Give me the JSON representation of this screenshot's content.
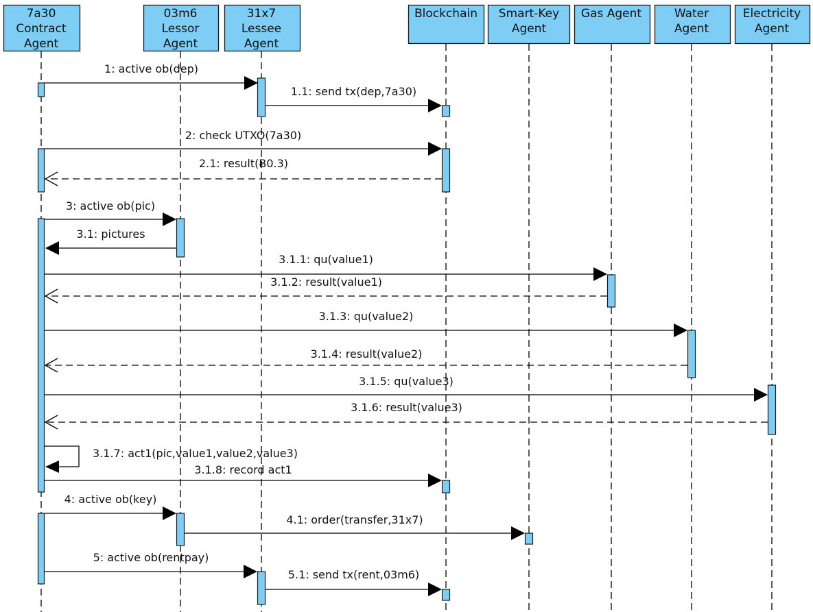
{
  "diagram": {
    "type": "sequence",
    "colors": {
      "box_fill": "#7dcdf4",
      "box_stroke": "#1a1a1a",
      "line": "#000000",
      "text": "#111111"
    },
    "participants": [
      {
        "id": "contract",
        "lines": [
          "7a30",
          "Contract",
          "Agent"
        ]
      },
      {
        "id": "lessor",
        "lines": [
          "03m6",
          "Lessor",
          "Agent"
        ]
      },
      {
        "id": "lessee",
        "lines": [
          "31x7",
          "Lessee",
          "Agent"
        ]
      },
      {
        "id": "blockchain",
        "lines": [
          "Blockchain"
        ]
      },
      {
        "id": "smartkey",
        "lines": [
          "Smart-Key",
          "Agent"
        ]
      },
      {
        "id": "gas",
        "lines": [
          "Gas Agent"
        ]
      },
      {
        "id": "water",
        "lines": [
          "Water",
          "Agent"
        ]
      },
      {
        "id": "electricity",
        "lines": [
          "Electricity",
          "Agent"
        ]
      }
    ],
    "messages": [
      {
        "seq": "1",
        "label": "1: active ob(dep)",
        "from": "contract",
        "to": "lessee",
        "kind": "sync"
      },
      {
        "seq": "1.1",
        "label": "1.1: send tx(dep,7a30)",
        "from": "lessee",
        "to": "blockchain",
        "kind": "sync"
      },
      {
        "seq": "2",
        "label": "2: check UTXO(7a30)",
        "from": "contract",
        "to": "blockchain",
        "kind": "sync"
      },
      {
        "seq": "2.1",
        "label": "2.1: result(Ƀ0.3)",
        "from": "blockchain",
        "to": "contract",
        "kind": "return"
      },
      {
        "seq": "3",
        "label": "3: active ob(pic)",
        "from": "contract",
        "to": "lessor",
        "kind": "sync"
      },
      {
        "seq": "3.1",
        "label": "3.1: pictures",
        "from": "lessor",
        "to": "contract",
        "kind": "sync"
      },
      {
        "seq": "3.1.1",
        "label": "3.1.1: qu(value1)",
        "from": "contract",
        "to": "gas",
        "kind": "sync"
      },
      {
        "seq": "3.1.2",
        "label": "3.1.2: result(value1)",
        "from": "gas",
        "to": "contract",
        "kind": "return"
      },
      {
        "seq": "3.1.3",
        "label": "3.1.3: qu(value2)",
        "from": "contract",
        "to": "water",
        "kind": "sync"
      },
      {
        "seq": "3.1.4",
        "label": "3.1.4: result(value2)",
        "from": "water",
        "to": "contract",
        "kind": "return"
      },
      {
        "seq": "3.1.5",
        "label": "3.1.5: qu(value3)",
        "from": "contract",
        "to": "electricity",
        "kind": "sync"
      },
      {
        "seq": "3.1.6",
        "label": "3.1.6: result(value3)",
        "from": "electricity",
        "to": "contract",
        "kind": "return"
      },
      {
        "seq": "3.1.7",
        "label": "3.1.7: act1(pic,value1,value2,value3)",
        "from": "contract",
        "to": "contract",
        "kind": "self"
      },
      {
        "seq": "3.1.8",
        "label": "3.1.8: record act1",
        "from": "contract",
        "to": "blockchain",
        "kind": "sync"
      },
      {
        "seq": "4",
        "label": "4: active ob(key)",
        "from": "contract",
        "to": "lessor",
        "kind": "sync"
      },
      {
        "seq": "4.1",
        "label": "4.1: order(transfer,31x7)",
        "from": "lessor",
        "to": "smartkey",
        "kind": "sync"
      },
      {
        "seq": "5",
        "label": "5: active ob(rentpay)",
        "from": "contract",
        "to": "lessee",
        "kind": "sync"
      },
      {
        "seq": "5.1",
        "label": "5.1: send tx(rent,03m6)",
        "from": "lessee",
        "to": "blockchain",
        "kind": "sync"
      }
    ]
  }
}
